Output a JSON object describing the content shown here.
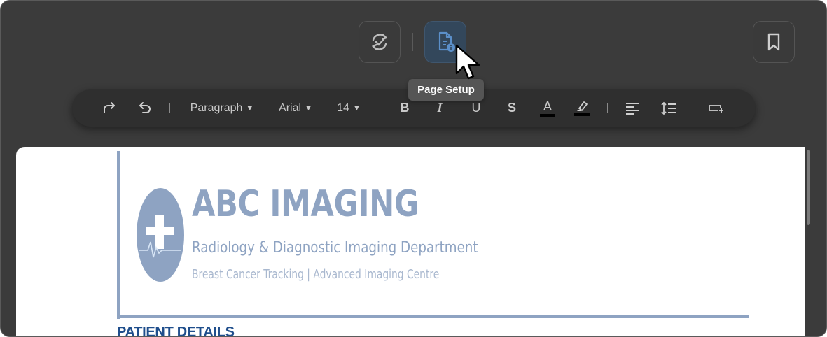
{
  "header": {
    "tooltip": "Page Setup",
    "buttons": [
      {
        "name": "sync-check-button",
        "icon": "sync-check-icon"
      },
      {
        "name": "page-setup-button",
        "icon": "document-info-icon",
        "active": true
      },
      {
        "name": "bookmark-button",
        "icon": "bookmark-icon"
      }
    ]
  },
  "toolbar": {
    "redo_icon": "redo-icon",
    "undo_icon": "undo-icon",
    "paragraph_style": "Paragraph",
    "font_family": "Arial",
    "font_size": "14",
    "bold": "B",
    "italic": "I",
    "underline": "U",
    "strikethrough": "S",
    "text_color": "A",
    "highlight_icon": "highlighter-icon",
    "align_icon": "align-left-icon",
    "line_spacing_icon": "line-spacing-icon",
    "insert_icon": "insert-field-icon"
  },
  "document": {
    "title": "ABC IMAGING",
    "subtitle": "Radiology & Diagnostic Imaging Department",
    "tagline": "Breast Cancer Tracking  |  Advanced Imaging Centre",
    "section_heading": "PATIENT DETAILS"
  },
  "colors": {
    "window_bg": "#3b3b3b",
    "active_button_bg": "#33475b",
    "accent_icon": "#5b8fc9",
    "logo_blue": "#8ea3c2",
    "heading_blue": "#1f4e8c"
  }
}
